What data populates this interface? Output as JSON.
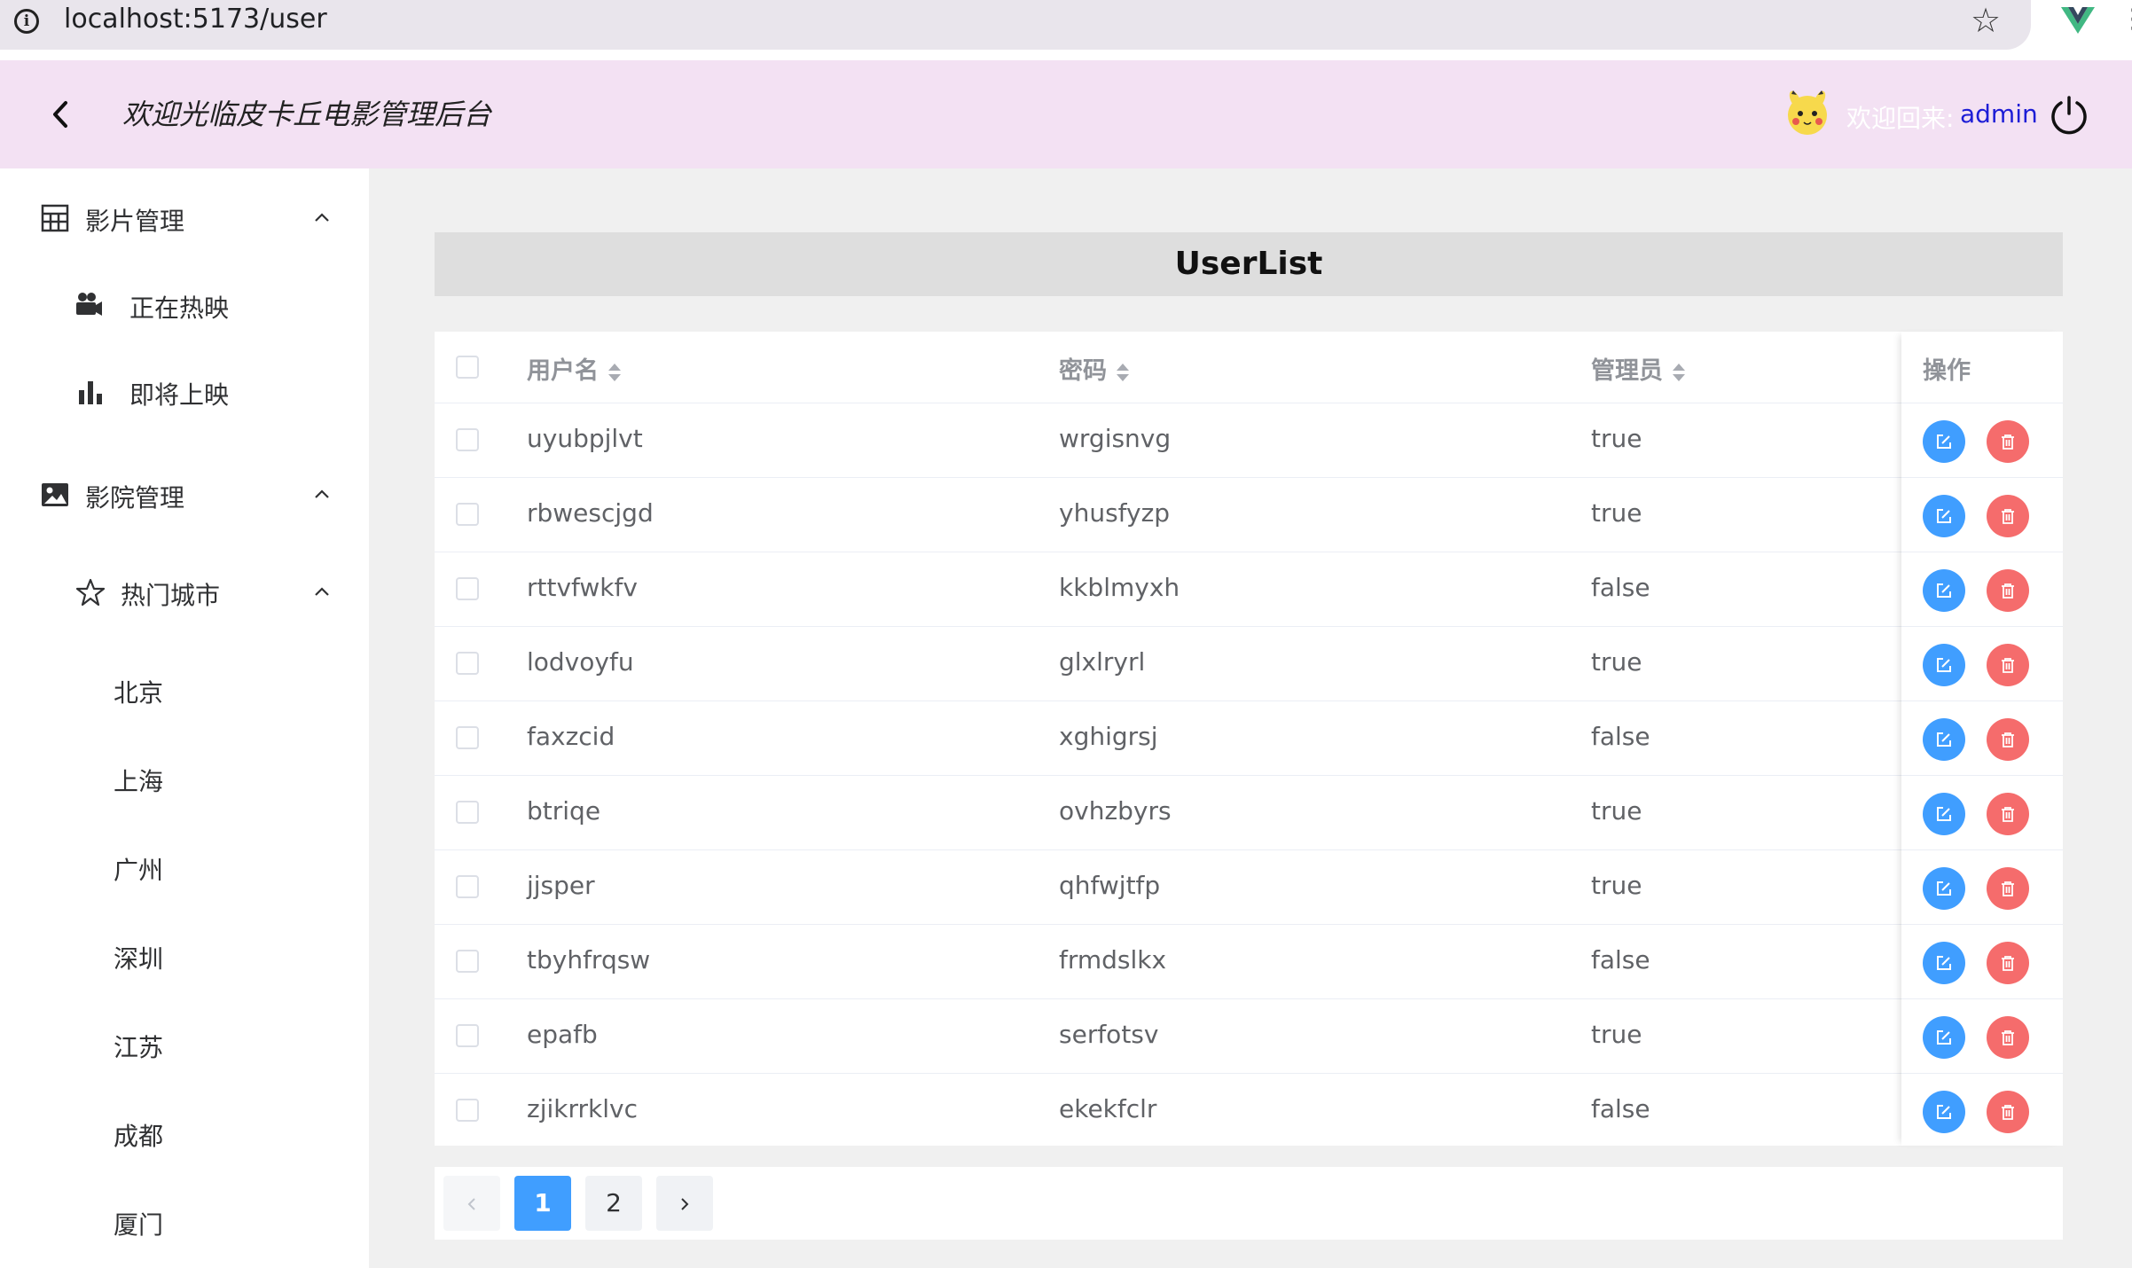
{
  "browser": {
    "url": "localhost:5173/user"
  },
  "header": {
    "title": "欢迎光临皮卡丘电影管理后台",
    "welcome_prefix": "欢迎回来:",
    "username": "admin"
  },
  "sidebar": {
    "movie_group": "影片管理",
    "now_showing": "正在热映",
    "coming_soon": "即将上映",
    "cinema_group": "影院管理",
    "hot_cities": "热门城市",
    "cities": [
      "北京",
      "上海",
      "广州",
      "深圳",
      "江苏",
      "成都",
      "厦门"
    ]
  },
  "main": {
    "list_title": "UserList",
    "columns": {
      "username": "用户名",
      "password": "密码",
      "admin": "管理员",
      "actions": "操作"
    },
    "rows": [
      {
        "username": "uyubpjlvt",
        "password": "wrgisnvg",
        "admin": "true"
      },
      {
        "username": "rbwescjgd",
        "password": "yhusfyzp",
        "admin": "true"
      },
      {
        "username": "rttvfwkfv",
        "password": "kkblmyxh",
        "admin": "false"
      },
      {
        "username": "lodvoyfu",
        "password": "glxlryrl",
        "admin": "true"
      },
      {
        "username": "faxzcid",
        "password": "xghigrsj",
        "admin": "false"
      },
      {
        "username": "btriqe",
        "password": "ovhzbyrs",
        "admin": "true"
      },
      {
        "username": "jjsper",
        "password": "qhfwjtfp",
        "admin": "true"
      },
      {
        "username": "tbyhfrqsw",
        "password": "frmdslkx",
        "admin": "false"
      },
      {
        "username": "epafb",
        "password": "serfotsv",
        "admin": "true"
      },
      {
        "username": "zjikrrklvc",
        "password": "ekekfclr",
        "admin": "false"
      }
    ]
  },
  "pagination": {
    "pages": [
      "1",
      "2"
    ],
    "current": "1"
  },
  "colors": {
    "primary": "#409eff",
    "danger": "#f56c6c",
    "header_bg": "#f3e1f3"
  }
}
